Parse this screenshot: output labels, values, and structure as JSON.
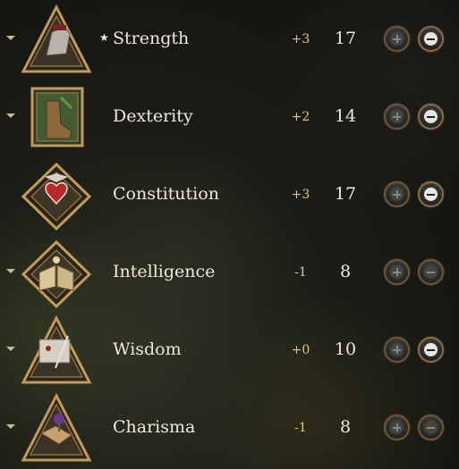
{
  "abilities": [
    {
      "name": "Strength",
      "featured": true,
      "star": "★",
      "modifier": "+3",
      "score": "17",
      "icon": "gauntlet-icon",
      "collapsible": true,
      "minus_enabled": true
    },
    {
      "name": "Dexterity",
      "featured": false,
      "star": "",
      "modifier": "+2",
      "score": "14",
      "icon": "boot-icon",
      "collapsible": true,
      "minus_enabled": true
    },
    {
      "name": "Constitution",
      "featured": false,
      "star": "",
      "modifier": "+3",
      "score": "17",
      "icon": "heart-shield-icon",
      "collapsible": false,
      "minus_enabled": true
    },
    {
      "name": "Intelligence",
      "featured": false,
      "star": "",
      "modifier": "-1",
      "score": "8",
      "icon": "book-icon",
      "collapsible": true,
      "minus_enabled": false
    },
    {
      "name": "Wisdom",
      "featured": false,
      "star": "",
      "modifier": "+0",
      "score": "10",
      "icon": "scroll-quill-icon",
      "collapsible": true,
      "minus_enabled": true
    },
    {
      "name": "Charisma",
      "featured": false,
      "star": "",
      "modifier": "-1",
      "score": "8",
      "icon": "handshake-rose-icon",
      "collapsible": true,
      "minus_enabled": false
    }
  ],
  "colors": {
    "frame_gold": "#c29a5c",
    "modifier_gold": "#e2c78a",
    "text": "#efe8da",
    "button_rim": "#8a6a47"
  }
}
